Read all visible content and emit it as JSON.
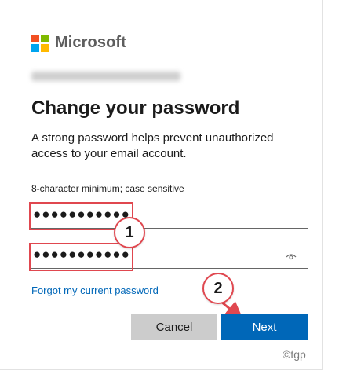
{
  "brand": {
    "name": "Microsoft",
    "colors": [
      "#f25022",
      "#7fba00",
      "#00a4ef",
      "#ffb900"
    ]
  },
  "account": {
    "email_display": "blurred"
  },
  "heading": "Change your password",
  "description": "A strong password helps prevent unauthorized access to your email account.",
  "hint": "8-character minimum; case sensitive",
  "fields": {
    "new_password": "●●●●●●●●●●●",
    "confirm_password": "●●●●●●●●●●●"
  },
  "annotations": {
    "step1": "1",
    "step2": "2"
  },
  "links": {
    "forgot": "Forgot my current password"
  },
  "buttons": {
    "cancel": "Cancel",
    "next": "Next"
  },
  "watermark": "©tgp",
  "colors": {
    "accent": "#0067b8",
    "annotation": "#e0474f"
  }
}
